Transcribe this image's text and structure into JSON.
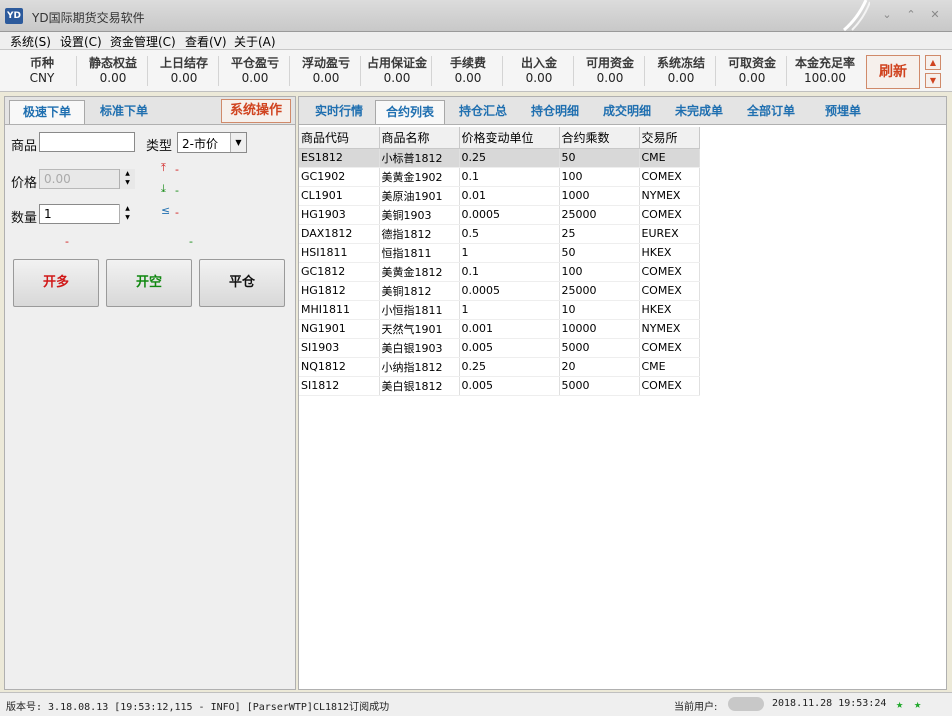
{
  "window": {
    "title": "YD国际期货交易软件",
    "logo_text": "YD"
  },
  "menu": [
    {
      "label": "系统(S)"
    },
    {
      "label": "设置(C)"
    },
    {
      "label": "资金管理(C)"
    },
    {
      "label": "查看(V)"
    },
    {
      "label": "关于(A)"
    }
  ],
  "account": {
    "columns": [
      {
        "label": "币种",
        "value": "CNY"
      },
      {
        "label": "静态权益",
        "value": "0.00"
      },
      {
        "label": "上日结存",
        "value": "0.00"
      },
      {
        "label": "平仓盈亏",
        "value": "0.00"
      },
      {
        "label": "浮动盈亏",
        "value": "0.00"
      },
      {
        "label": "占用保证金",
        "value": "0.00"
      },
      {
        "label": "手续费",
        "value": "0.00"
      },
      {
        "label": "出入金",
        "value": "0.00"
      },
      {
        "label": "可用资金",
        "value": "0.00"
      },
      {
        "label": "系统冻结",
        "value": "0.00"
      },
      {
        "label": "可取资金",
        "value": "0.00"
      },
      {
        "label": "本金充足率",
        "value": "100.00"
      }
    ],
    "refresh_label": "刷新"
  },
  "order_panel": {
    "tabs": [
      {
        "label": "极速下单"
      },
      {
        "label": "标准下单"
      }
    ],
    "sysop_label": "系统操作",
    "product_label": "商品",
    "product_value": "",
    "type_label": "类型",
    "type_value": "2-市价",
    "price_label": "价格",
    "price_value": "0.00",
    "qty_label": "数量",
    "qty_value": "1",
    "upper_limit": "-",
    "lower_limit": "-",
    "le_value": "-",
    "bid_hint": "-",
    "ask_hint": "-",
    "buttons": {
      "open_long": "开多",
      "open_short": "开空",
      "close": "平仓"
    },
    "colors": {
      "open_long": "#d01818",
      "open_short": "#108810",
      "close": "#111111"
    }
  },
  "main_tabs": [
    {
      "label": "实时行情"
    },
    {
      "label": "合约列表"
    },
    {
      "label": "持仓汇总"
    },
    {
      "label": "持仓明细"
    },
    {
      "label": "成交明细"
    },
    {
      "label": "未完成单"
    },
    {
      "label": "全部订单"
    },
    {
      "label": "预埋单"
    }
  ],
  "contracts": {
    "headers": [
      "商品代码",
      "商品名称",
      "价格变动单位",
      "合约乘数",
      "交易所"
    ],
    "rows": [
      [
        "ES1812",
        "小标普1812",
        "0.25",
        "50",
        "CME"
      ],
      [
        "GC1902",
        "美黄金1902",
        "0.1",
        "100",
        "COMEX"
      ],
      [
        "CL1901",
        "美原油1901",
        "0.01",
        "1000",
        "NYMEX"
      ],
      [
        "HG1903",
        "美铜1903",
        "0.0005",
        "25000",
        "COMEX"
      ],
      [
        "DAX1812",
        "德指1812",
        "0.5",
        "25",
        "EUREX"
      ],
      [
        "HSI1811",
        "恒指1811",
        "1",
        "50",
        "HKEX"
      ],
      [
        "GC1812",
        "美黄金1812",
        "0.1",
        "100",
        "COMEX"
      ],
      [
        "HG1812",
        "美铜1812",
        "0.0005",
        "25000",
        "COMEX"
      ],
      [
        "MHI1811",
        "小恒指1811",
        "1",
        "10",
        "HKEX"
      ],
      [
        "NG1901",
        "天然气1901",
        "0.001",
        "10000",
        "NYMEX"
      ],
      [
        "SI1903",
        "美白银1903",
        "0.005",
        "5000",
        "COMEX"
      ],
      [
        "NQ1812",
        "小纳指1812",
        "0.25",
        "20",
        "CME"
      ],
      [
        "SI1812",
        "美白银1812",
        "0.005",
        "5000",
        "COMEX"
      ]
    ]
  },
  "status": {
    "message": "版本号: 3.18.08.13  [19:53:12,115 -  INFO] [ParserWTP]CL1812订阅成功",
    "user_label": "当前用户:",
    "datetime": "2018.11.28 19:53:24"
  }
}
